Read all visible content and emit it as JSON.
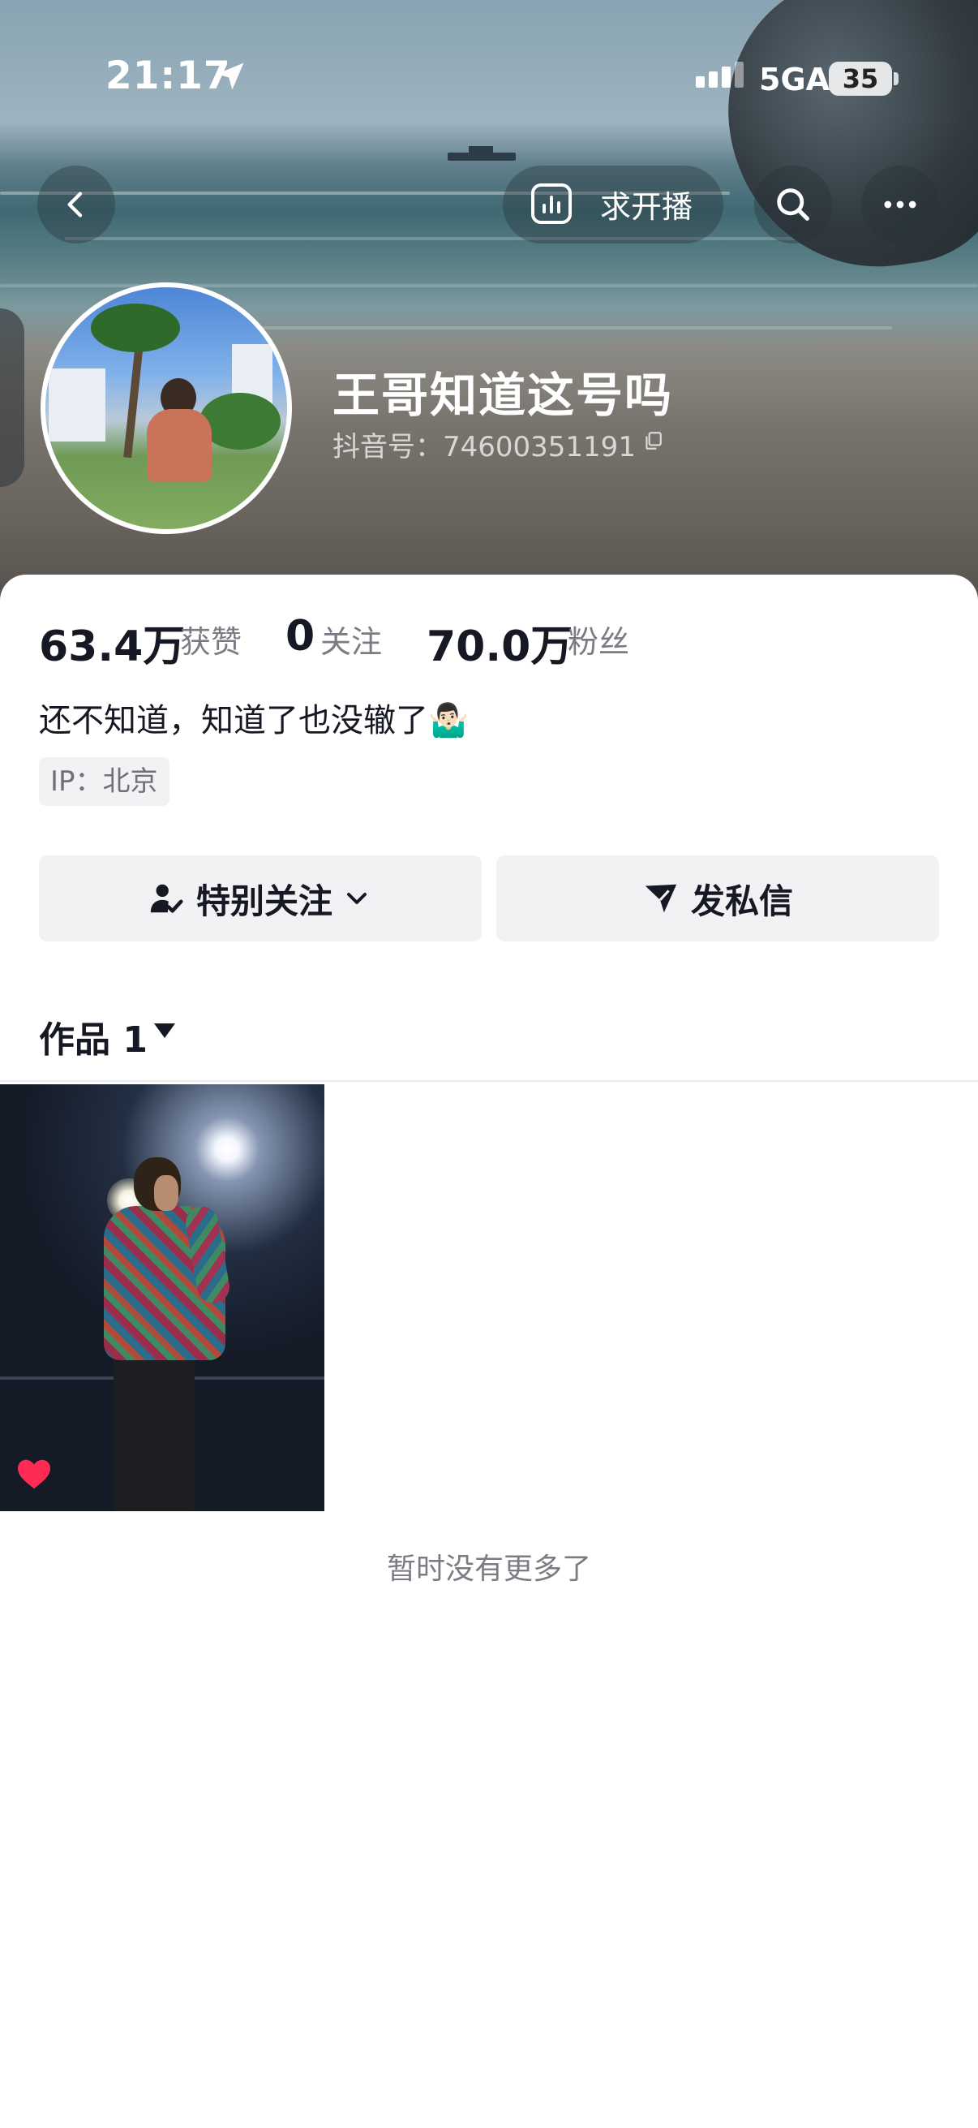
{
  "status_bar": {
    "time": "21:17",
    "network": "5GA",
    "battery": "35"
  },
  "header": {
    "live_label": "求开播",
    "nickname": "王哥知道这号吗",
    "douyin_id": "抖音号：74600351191"
  },
  "stats": [
    {
      "value": "63.4万",
      "label": "获赞"
    },
    {
      "value": "0",
      "label": "关注"
    },
    {
      "value": "70.0万",
      "label": "粉丝"
    }
  ],
  "bio": "还不知道，知道了也没辙了🤷🏻‍♂️",
  "ip_tag": "IP：北京",
  "actions": {
    "follow_label": "特别关注",
    "message_label": "发私信"
  },
  "works_tab": {
    "label": "作品 1"
  },
  "footer_text": "暂时没有更多了",
  "colors": {
    "accent_heart": "#fe2c55",
    "card_bg": "#ffffff",
    "button_bg": "#f2f2f4"
  }
}
